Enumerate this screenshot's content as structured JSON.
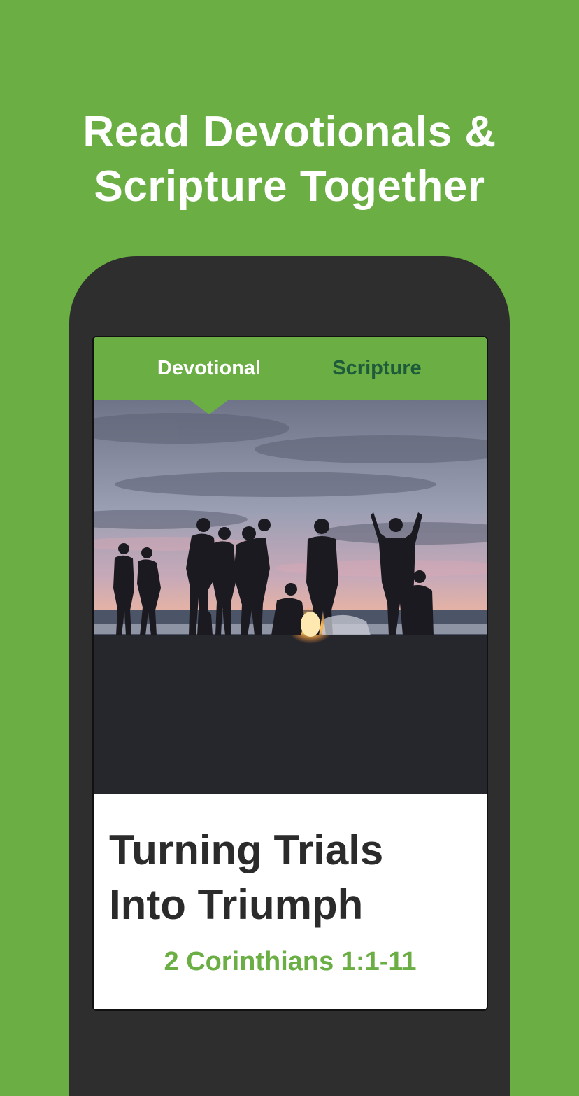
{
  "headline": {
    "line1": "Read Devotionals &",
    "line2": "Scripture Together"
  },
  "tabs": [
    {
      "label": "Devotional",
      "active": true
    },
    {
      "label": "Scripture",
      "active": false
    }
  ],
  "devotional": {
    "title_line1": "Turning Trials",
    "title_line2": "Into Triumph",
    "reference": "2 Corinthians 1:1-11"
  },
  "colors": {
    "brand_green": "#6aae44",
    "phone_frame": "#2e2e2e",
    "inactive_tab": "#1e5b3a",
    "title_text": "#2b2b2b"
  }
}
